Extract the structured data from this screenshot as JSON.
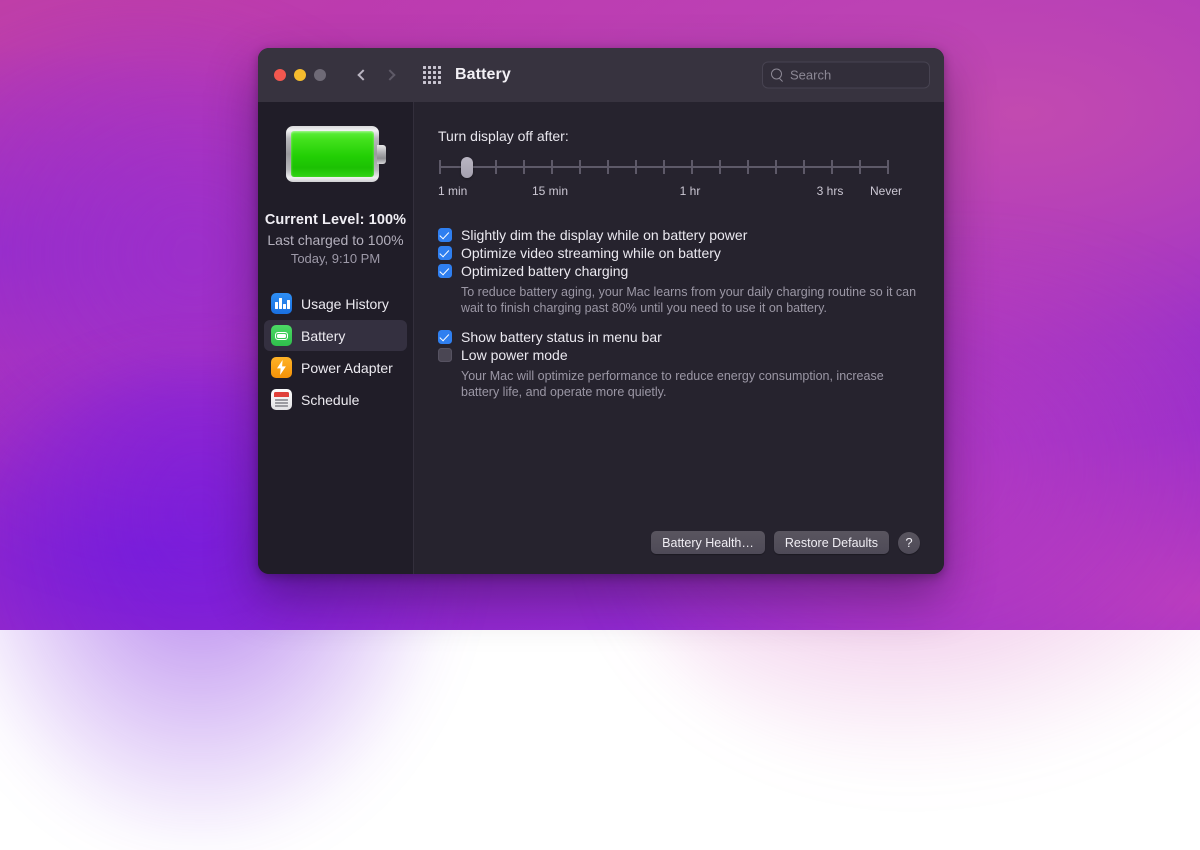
{
  "window": {
    "title": "Battery",
    "traffic_lights": {
      "close": "close",
      "minimize": "minimize",
      "zoom": "zoom"
    },
    "nav": {
      "back": "back",
      "forward": "forward"
    },
    "grid_button": "show-all-preferences",
    "colors": {
      "titlebar": "#37333f",
      "sidebar": "#201d28",
      "content": "#26232e",
      "accent_checkbox": "#2f7ff0",
      "battery_green": "#22cf04"
    }
  },
  "search": {
    "placeholder": "Search",
    "value": ""
  },
  "sidebar": {
    "battery_icon": "battery-full-icon",
    "current_level": "Current Level: 100%",
    "last_charged": "Last charged to 100%",
    "charge_time": "Today, 9:10 PM",
    "items": [
      {
        "label": "Usage History",
        "icon": "usage-history-icon",
        "selected": false
      },
      {
        "label": "Battery",
        "icon": "battery-icon",
        "selected": true
      },
      {
        "label": "Power Adapter",
        "icon": "power-adapter-icon",
        "selected": false
      },
      {
        "label": "Schedule",
        "icon": "schedule-icon",
        "selected": false
      }
    ]
  },
  "main": {
    "slider": {
      "label": "Turn display off after:",
      "value": "1 min",
      "tick_count": 16,
      "thumb_position_index": 1,
      "tick_labels": [
        {
          "text": "1 min",
          "pos": 0
        },
        {
          "text": "15 min",
          "pos": 4
        },
        {
          "text": "1 hr",
          "pos": 9
        },
        {
          "text": "3 hrs",
          "pos": 14
        },
        {
          "text": "Never",
          "pos": 16
        }
      ]
    },
    "checkboxes": [
      {
        "label": "Slightly dim the display while on battery power",
        "checked": true,
        "description": ""
      },
      {
        "label": "Optimize video streaming while on battery",
        "checked": true,
        "description": ""
      },
      {
        "label": "Optimized battery charging",
        "checked": true,
        "description": "To reduce battery aging, your Mac learns from your daily charging routine so it can wait to finish charging past 80% until you need to use it on battery."
      },
      {
        "label": "Show battery status in menu bar",
        "checked": true,
        "description": ""
      },
      {
        "label": "Low power mode",
        "checked": false,
        "description": "Your Mac will optimize performance to reduce energy consumption, increase battery life, and operate more quietly."
      }
    ],
    "footer": {
      "battery_health": "Battery Health…",
      "restore_defaults": "Restore Defaults",
      "help": "?"
    }
  }
}
